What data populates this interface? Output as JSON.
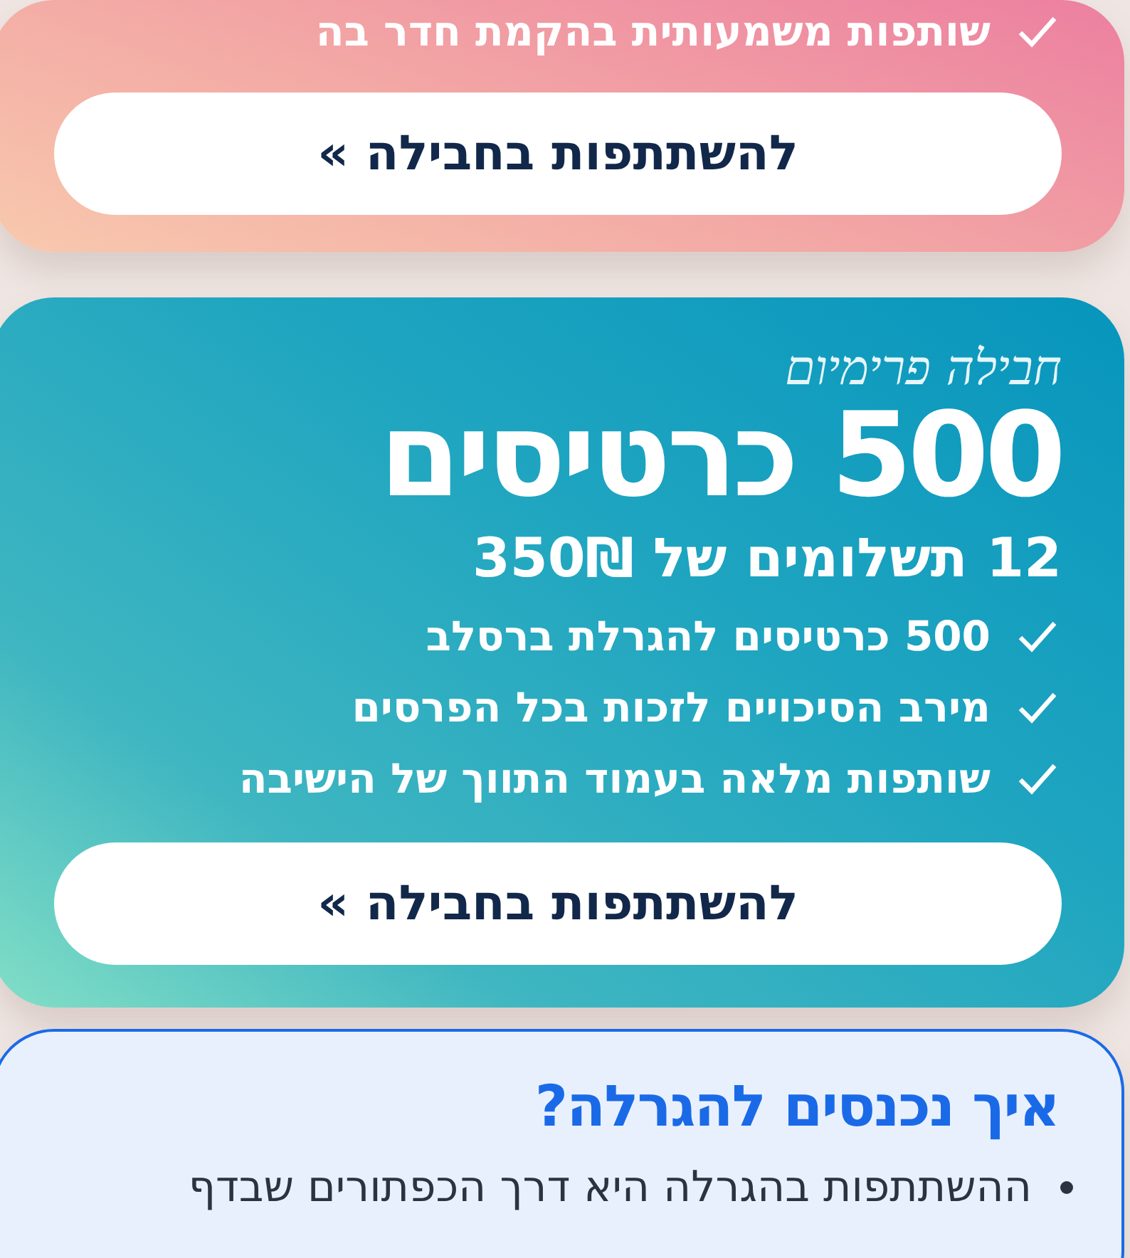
{
  "top_card": {
    "features": [
      "שותפות משמעותית בהקמת חדר בה"
    ],
    "button": "להשתתפות בחבילה »"
  },
  "premium_card": {
    "tagline": "חבילה פרימיום",
    "headline": "500 כרטיסים",
    "price": "12 תשלומים של 350₪",
    "features": [
      "500 כרטיסים להגרלת ברסלב",
      "מירב הסיכויים לזכות בכל הפרסים",
      "שותפות מלאה בעמוד התווך של הישיבה"
    ],
    "button": "להשתתפות בחבילה »"
  },
  "info_card": {
    "title": "איך נכנסים להגרלה?",
    "bullets": [
      "ההשתתפות בהגרלה היא דרך הכפתורים שבדף"
    ]
  }
}
